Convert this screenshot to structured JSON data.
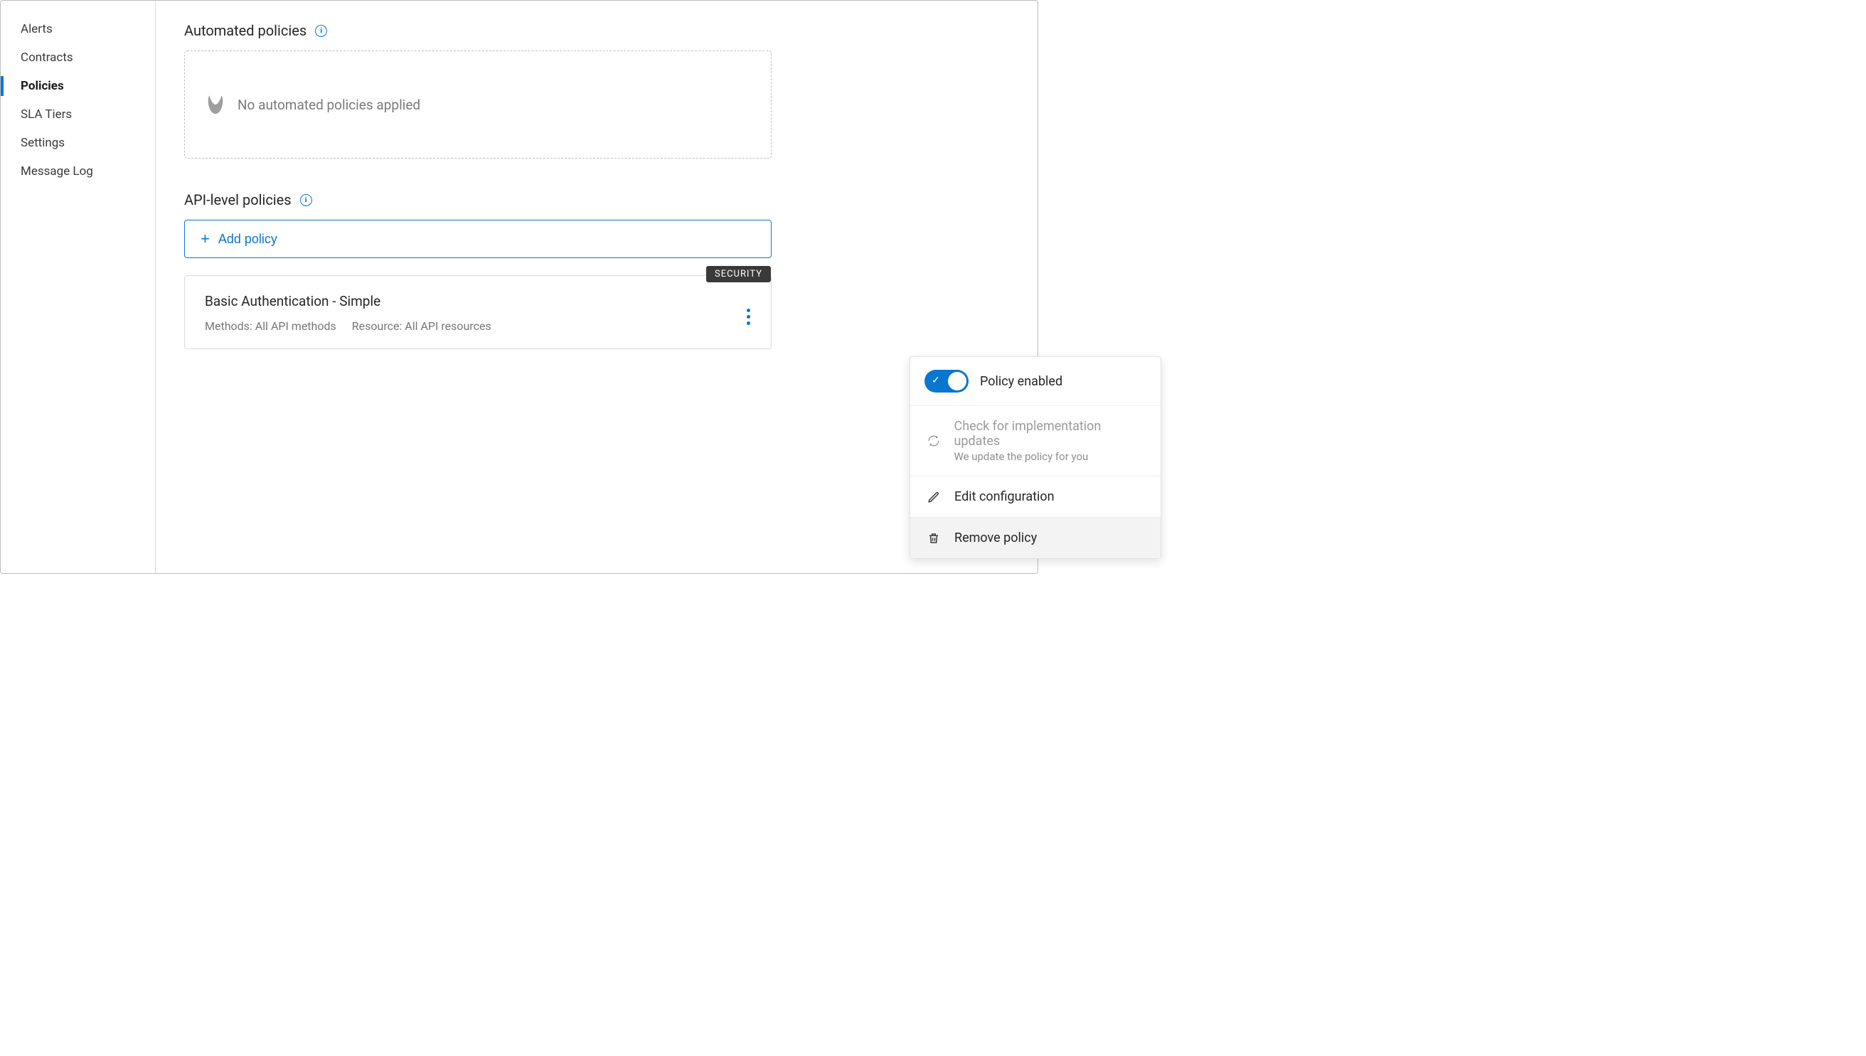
{
  "sidebar": {
    "items": [
      {
        "label": "Alerts"
      },
      {
        "label": "Contracts"
      },
      {
        "label": "Policies"
      },
      {
        "label": "SLA Tiers"
      },
      {
        "label": "Settings"
      },
      {
        "label": "Message Log"
      }
    ],
    "active_index": 2
  },
  "sections": {
    "automated": {
      "title": "Automated policies",
      "empty_text": "No automated policies applied"
    },
    "api_level": {
      "title": "API-level policies",
      "add_button": "Add policy"
    }
  },
  "policy": {
    "badge": "SECURITY",
    "title": "Basic Authentication - Simple",
    "methods": "Methods: All API methods",
    "resource": "Resource: All API resources"
  },
  "menu": {
    "enabled_label": "Policy enabled",
    "check_updates_label": "Check for implementation updates",
    "check_updates_sub": "We update the policy for you",
    "edit_label": "Edit configuration",
    "remove_label": "Remove policy"
  }
}
